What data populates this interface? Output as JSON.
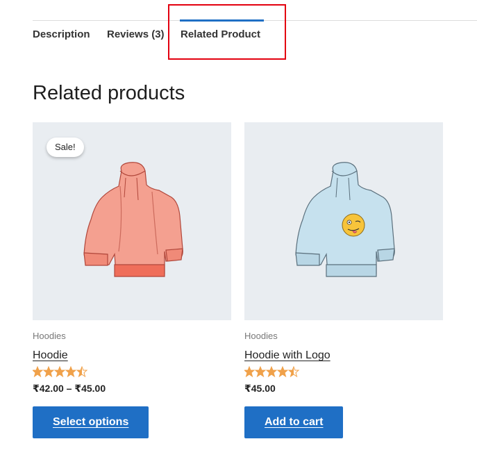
{
  "tabs": [
    {
      "label": "Description"
    },
    {
      "label": "Reviews (3)"
    },
    {
      "label": "Related Product"
    }
  ],
  "section_title": "Related products",
  "products": [
    {
      "badge": "Sale!",
      "category": "Hoodies",
      "name": "Hoodie",
      "rating": 4.5,
      "price": "₹42.00 – ₹45.00",
      "button": "Select options",
      "image": "hoodie-image"
    },
    {
      "category": "Hoodies",
      "name": "Hoodie with Logo",
      "rating": 4.5,
      "price": "₹45.00",
      "button": "Add to cart",
      "image": "hoodie-with-logo-image"
    }
  ],
  "colors": {
    "accent": "#1f6fc5",
    "highlight": "#e3000f",
    "star": "#f0a14a",
    "thumb_bg": "#e9edf1"
  }
}
